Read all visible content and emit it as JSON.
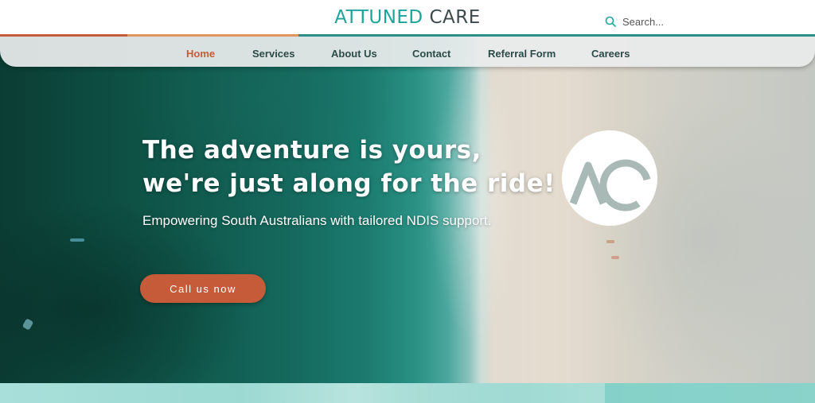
{
  "brand": {
    "name_part1": "ATTUNED",
    "name_part2": "CARE"
  },
  "search": {
    "placeholder": "Search..."
  },
  "nav": {
    "items": [
      {
        "label": "Home",
        "active": true
      },
      {
        "label": "Services",
        "active": false
      },
      {
        "label": "About Us",
        "active": false
      },
      {
        "label": "Contact",
        "active": false
      },
      {
        "label": "Referral Form",
        "active": false
      },
      {
        "label": "Careers",
        "active": false
      }
    ]
  },
  "hero": {
    "headline_line1": "The adventure is yours,",
    "headline_line2": "we're just along for the ride!",
    "subheading": "Empowering South Australians with tailored NDIS support.",
    "cta_label": "Call us now"
  },
  "icons": {
    "search": "search-icon",
    "badge": "ac-logo-badge"
  },
  "colors": {
    "brand_teal": "#1ea49a",
    "brand_dark": "#3f4a4d",
    "accent_orange": "#c65b3a",
    "nav_text": "#2c4a47",
    "badge_mark": "#a9b9b5"
  }
}
